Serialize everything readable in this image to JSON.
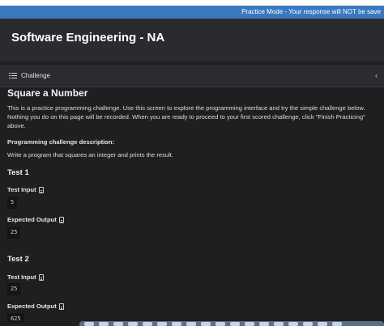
{
  "banner": {
    "text": "Practice Mode - Your response will NOT be save"
  },
  "app": {
    "title": "Software Engineering - NA"
  },
  "panel": {
    "tab_label": "Challenge",
    "collapse_icon": "chevron-left-icon"
  },
  "problem": {
    "title": "Square a Number",
    "intro": "This is a practice programming challenge. Use this screen to explore the programming interface and try the simple challenge below. Nothing you do on this page will be recorded. When you are ready to proceed to your first scored challenge, click \"Finish Practicing\" above.",
    "description_label": "Programming challenge description:",
    "description": "Write a program that squares an integer and prints the result."
  },
  "tests": [
    {
      "heading": "Test 1",
      "input_label": "Test Input",
      "input": "5",
      "output_label": "Expected Output",
      "output": "25"
    },
    {
      "heading": "Test 2",
      "input_label": "Test Input",
      "input": "25",
      "output_label": "Expected Output",
      "output": "625"
    }
  ],
  "colors": {
    "banner": "#3a78c0",
    "background": "#1e1f21",
    "header": "#2a2b2e",
    "code_box": "#141517"
  }
}
